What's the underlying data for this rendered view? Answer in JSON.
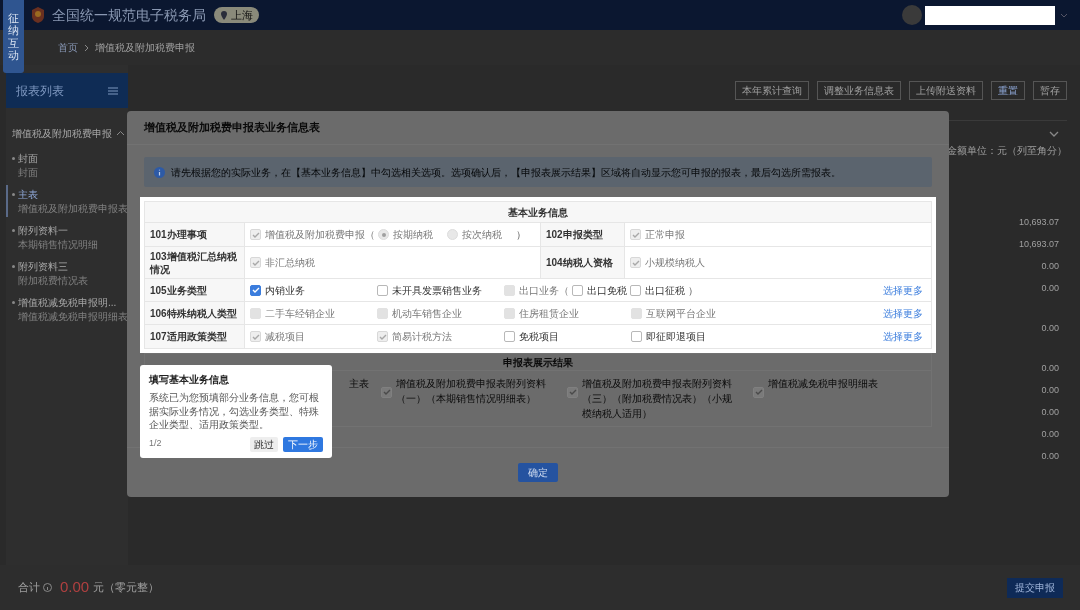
{
  "header": {
    "side_tab": "征纳互动",
    "title": "全国统一规范电子税务局",
    "region": "上海"
  },
  "breadcrumb": [
    "首页",
    "增值税及附加税费申报"
  ],
  "sidebar": {
    "title": "报表列表",
    "group": {
      "label": "增值税及附加税费申报",
      "expanded": true
    },
    "items": [
      {
        "label": "封面",
        "sub": "封面",
        "selected": false
      },
      {
        "label": "主表",
        "sub": "增值税及附加税费申报表",
        "selected": true
      },
      {
        "label": "附列资料一",
        "sub": "本期销售情况明细",
        "selected": false
      },
      {
        "label": "附列资料三",
        "sub": "附加税费情况表",
        "selected": false
      },
      {
        "label": "增值税减免税申报明...",
        "sub": "增值税减免税申报明细表",
        "selected": false
      }
    ]
  },
  "toolbar": [
    "本年累计查询",
    "调整业务信息表",
    "上传附送资料",
    "重置",
    "暂存"
  ],
  "unit_note": "金额单位：元（列至角分）",
  "amounts": [
    "10,693.07",
    "10,693.07",
    "0.00",
    "0.00",
    "0.00",
    "0.00",
    "0.00",
    "0.00",
    "0.00",
    "0.00"
  ],
  "modal": {
    "title": "增值税及附加税费申报表业务信息表",
    "info": "请先根据您的实际业务，在【基本业务信息】中勾选相关选项。选项确认后，【申报表展示结果】区域将自动显示您可申报的报表，最后勾选所需报表。",
    "basic_info": {
      "title": "基本业务信息",
      "rows": [
        {
          "kind": "pair",
          "label": "101办理事项",
          "options": [
            {
              "kind": "checkbox",
              "label": "增值税及附加税费申报（",
              "checked": true,
              "disabled": true
            },
            {
              "kind": "radio",
              "label": "按期纳税",
              "selected": true,
              "disabled": true
            },
            {
              "kind": "radio",
              "label": "按次纳税",
              "selected": false,
              "disabled": true
            },
            {
              "kind": "text",
              "label": "）"
            }
          ],
          "label2": "102申报类型",
          "options2": [
            {
              "kind": "checkbox",
              "label": "正常申报",
              "checked": true,
              "disabled": true
            }
          ]
        },
        {
          "kind": "pair",
          "label": "103增值税汇总纳税情况",
          "options": [
            {
              "kind": "checkbox",
              "label": "非汇总纳税",
              "checked": true,
              "disabled": true
            }
          ],
          "label2": "104纳税人资格",
          "options2": [
            {
              "kind": "checkbox",
              "label": "小规模纳税人",
              "checked": true,
              "disabled": true
            }
          ]
        },
        {
          "kind": "multi",
          "label": "105业务类型",
          "cells": [
            [
              {
                "kind": "checkbox",
                "label": "内销业务",
                "checked": true,
                "disabled": false
              }
            ],
            [
              {
                "kind": "checkbox",
                "label": "未开具发票销售业务",
                "checked": false,
                "disabled": false
              }
            ],
            [
              {
                "kind": "checkbox",
                "label": "出口业务（",
                "checked": false,
                "disabled": true
              },
              {
                "kind": "checkbox",
                "label": "出口免税",
                "checked": false,
                "disabled": false
              },
              {
                "kind": "checkbox",
                "label": "出口征税",
                "checked": false,
                "disabled": false
              },
              {
                "kind": "text",
                "label": "）"
              }
            ]
          ],
          "more": "选择更多"
        },
        {
          "kind": "multi",
          "label": "106特殊纳税人类型",
          "cells": [
            [
              {
                "kind": "checkbox",
                "label": "二手车经销企业",
                "checked": false,
                "disabled": true
              }
            ],
            [
              {
                "kind": "checkbox",
                "label": "机动车销售企业",
                "checked": false,
                "disabled": true
              }
            ],
            [
              {
                "kind": "checkbox",
                "label": "住房租赁企业",
                "checked": false,
                "disabled": true
              }
            ],
            [
              {
                "kind": "checkbox",
                "label": "互联网平台企业",
                "checked": false,
                "disabled": true
              }
            ]
          ],
          "more": "选择更多"
        },
        {
          "kind": "multi",
          "label": "107适用政策类型",
          "cells": [
            [
              {
                "kind": "checkbox",
                "label": "减税项目",
                "checked": true,
                "disabled": true
              }
            ],
            [
              {
                "kind": "checkbox",
                "label": "简易计税方法",
                "checked": true,
                "disabled": true
              }
            ],
            [
              {
                "kind": "checkbox",
                "label": "免税项目",
                "checked": false,
                "disabled": false
              }
            ],
            [
              {
                "kind": "checkbox",
                "label": "即征即退项目",
                "checked": false,
                "disabled": false
              }
            ]
          ],
          "more": "选择更多"
        }
      ]
    },
    "results": {
      "title": "申报表展示结果",
      "first": "主表",
      "items": [
        {
          "label": "增值税及附加税费申报表附列资料（一）（本期销售情况明细表）",
          "checked": true
        },
        {
          "label": "增值税及附加税费申报表附列资料（三）（附加税费情况表）（小规模纳税人适用）",
          "checked": true
        },
        {
          "label": "增值税减免税申报明细表",
          "checked": true
        }
      ]
    },
    "confirm": "确定"
  },
  "guide": {
    "title": "填写基本业务信息",
    "text": "系统已为您预填部分业务信息，您可根据实际业务情况，勾选业务类型、特殊企业类型、适用政策类型。",
    "step": "1/2",
    "skip": "跳过",
    "next": "下一步"
  },
  "footer": {
    "label": "合计",
    "amount": "0.00",
    "words": "元（零元整）",
    "submit": "提交申报"
  }
}
